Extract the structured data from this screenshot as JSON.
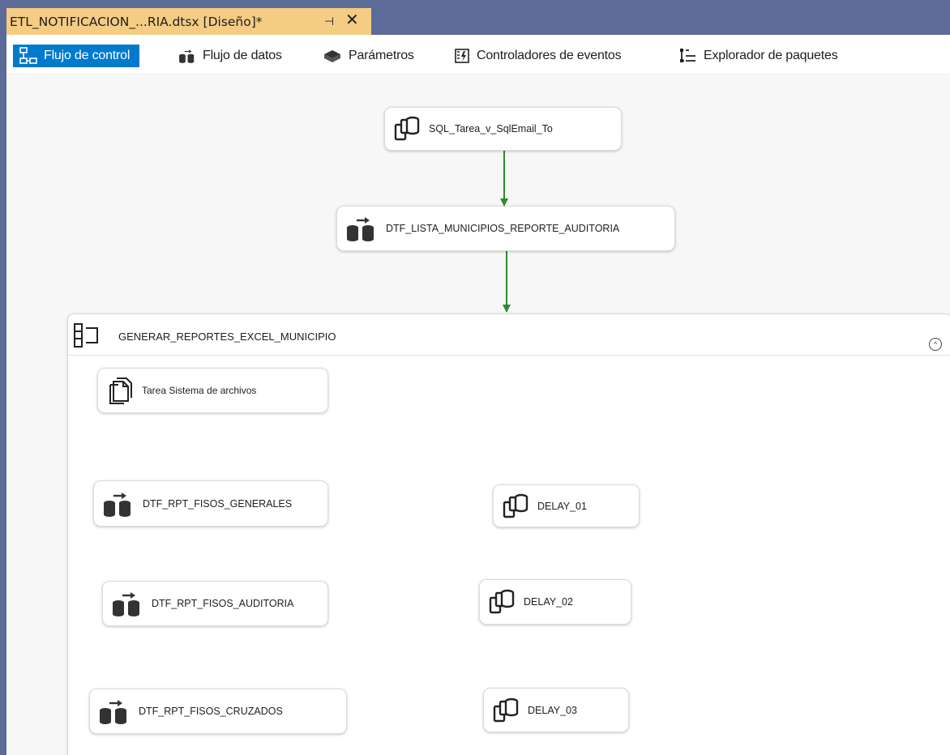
{
  "document_tab": {
    "title": "ETL_NOTIFICACION_...RIA.dtsx [Diseño]*",
    "pin_glyph": "⊣",
    "close_glyph": "✕"
  },
  "designer_tabs": [
    {
      "label": "Flujo de control",
      "icon": "control-flow-icon",
      "active": true
    },
    {
      "label": "Flujo de datos",
      "icon": "data-flow-icon",
      "active": false
    },
    {
      "label": "Parámetros",
      "icon": "parameters-icon",
      "active": false
    },
    {
      "label": "Controladores de eventos",
      "icon": "event-handlers-icon",
      "active": false
    },
    {
      "label": "Explorador de paquetes",
      "icon": "package-explorer-icon",
      "active": false
    }
  ],
  "tasks": {
    "sql_task": {
      "label": "SQL_Tarea_v_SqlEmail_To",
      "icon": "sql-task-icon"
    },
    "dtf_lista": {
      "label": "DTF_LISTA_MUNICIPIOS_REPORTE_AUDITORIA",
      "icon": "data-flow-task-icon"
    }
  },
  "container": {
    "title": "GENERAR_REPORTES_EXCEL_MUNICIPIO",
    "collapse_glyph": "^",
    "tasks": {
      "file_system": {
        "label": "Tarea Sistema de archivos",
        "icon": "file-system-task-icon"
      },
      "dtf_generales": {
        "label": "DTF_RPT_FISOS_GENERALES",
        "icon": "data-flow-task-icon"
      },
      "delay_01": {
        "label": "DELAY_01",
        "icon": "sql-task-icon"
      },
      "dtf_auditoria": {
        "label": "DTF_RPT_FISOS_AUDITORIA",
        "icon": "data-flow-task-icon"
      },
      "delay_02": {
        "label": "DELAY_02",
        "icon": "sql-task-icon"
      },
      "dtf_cruzados": {
        "label": "DTF_RPT_FISOS_CRUZADOS",
        "icon": "data-flow-task-icon"
      },
      "delay_03": {
        "label": "DELAY_03",
        "icon": "sql-task-icon"
      }
    }
  },
  "colors": {
    "tab_strip": "#5d6b99",
    "active_document_tab": "#f5cc84",
    "active_designer_tab": "#007acc",
    "precedence_constraint": "#2f8a2f",
    "canvas": "#f7f7f7"
  }
}
